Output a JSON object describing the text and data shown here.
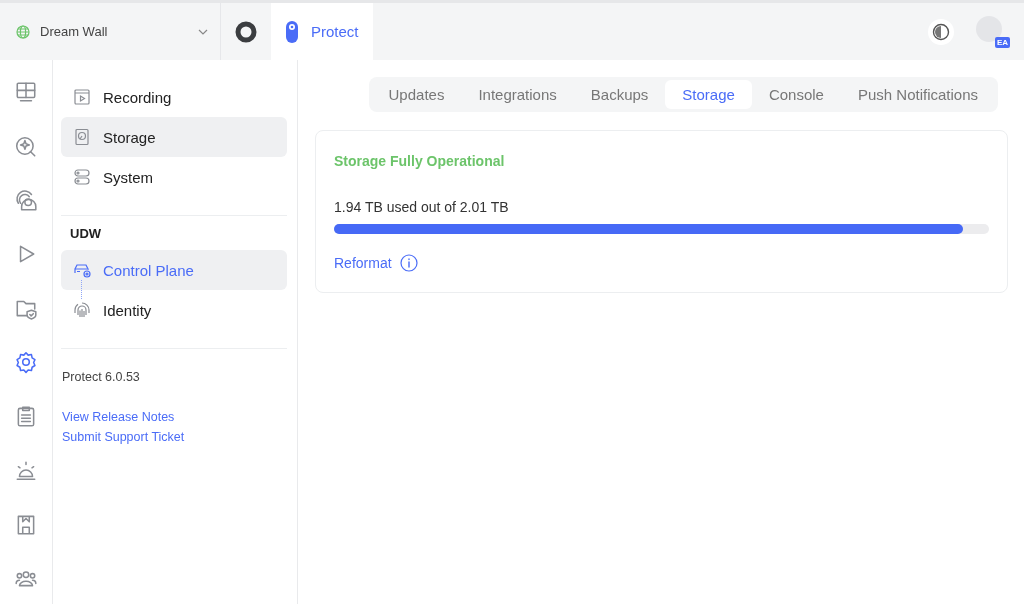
{
  "site": {
    "name": "Dream Wall"
  },
  "apps": [
    {
      "selected": false
    },
    {
      "label": "Protect",
      "selected": true
    }
  ],
  "user": {
    "initials": "EA"
  },
  "rail": [
    {
      "selected": false
    },
    {
      "selected": false
    },
    {
      "selected": false
    },
    {
      "selected": false
    },
    {
      "selected": false
    },
    {
      "selected": true
    },
    {
      "selected": false
    },
    {
      "selected": false
    },
    {
      "selected": false
    },
    {
      "selected": false
    }
  ],
  "settings_nav": {
    "items": [
      {
        "label": "Recording",
        "selected": false,
        "active": false
      },
      {
        "label": "Storage",
        "selected": true,
        "active": false
      },
      {
        "label": "System",
        "selected": false,
        "active": false
      }
    ],
    "section": {
      "title": "UDW",
      "items": [
        {
          "label": "Control Plane",
          "selected": true,
          "active": true
        },
        {
          "label": "Identity",
          "selected": false,
          "active": false
        }
      ]
    },
    "version": "Protect 6.0.53",
    "links": [
      "View Release Notes",
      "Submit Support Ticket"
    ]
  },
  "tabs": [
    {
      "label": "Updates",
      "selected": false
    },
    {
      "label": "Integrations",
      "selected": false
    },
    {
      "label": "Backups",
      "selected": false
    },
    {
      "label": "Storage",
      "selected": true
    },
    {
      "label": "Console",
      "selected": false
    },
    {
      "label": "Push Notifications",
      "selected": false
    }
  ],
  "storage": {
    "status": "Storage Fully Operational",
    "usage": "1.94 TB used out of 2.01 TB",
    "level": 0.96,
    "action": "Reformat"
  }
}
